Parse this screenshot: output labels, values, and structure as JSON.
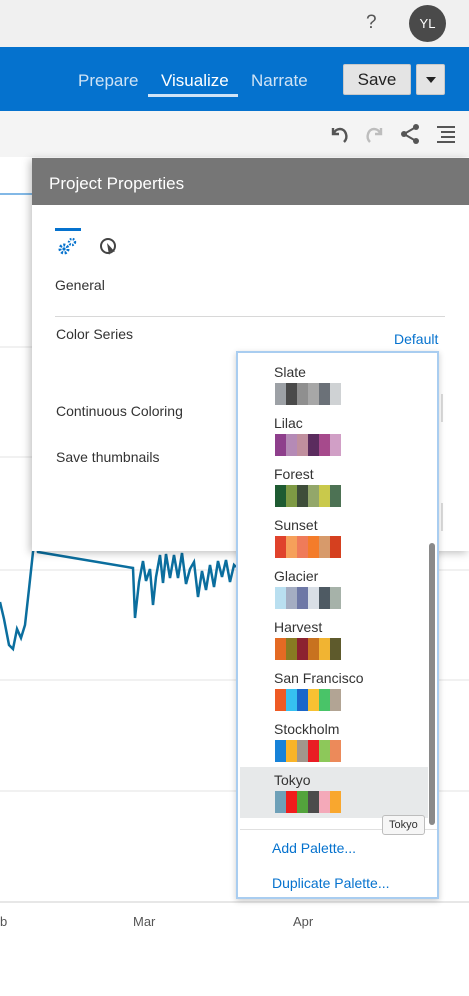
{
  "header": {
    "help_label": "?",
    "avatar_initials": "YL"
  },
  "nav": {
    "tabs": [
      {
        "label": "Prepare"
      },
      {
        "label": "Visualize"
      },
      {
        "label": "Narrate"
      }
    ],
    "active_tab": "Visualize",
    "save_label": "Save"
  },
  "toolbar": {
    "icons": [
      "undo-icon",
      "redo-icon",
      "share-icon",
      "menu-icon"
    ]
  },
  "chart": {
    "x_ticks": [
      "b",
      "Mar",
      "Apr"
    ]
  },
  "dialog": {
    "title": "Project Properties",
    "tabs": [
      "gear-icon",
      "cursor-icon"
    ],
    "section": "General",
    "properties": {
      "color_series": "Color Series",
      "continuous_coloring": "Continuous Coloring",
      "save_thumbnails": "Save thumbnails"
    },
    "color_series_value": "Default"
  },
  "palette_dropdown": {
    "palettes": [
      {
        "name": "Slate",
        "colors": [
          "#9da1a6",
          "#4a4a4a",
          "#8f8f8f",
          "#a7a7a7",
          "#6b7178",
          "#cfd2d4"
        ]
      },
      {
        "name": "Lilac",
        "colors": [
          "#8e3f8c",
          "#b58ab6",
          "#c08f9e",
          "#5b2c5e",
          "#a64a8c",
          "#d19fc6"
        ]
      },
      {
        "name": "Forest",
        "colors": [
          "#1e5b32",
          "#7e9a44",
          "#3e4d3a",
          "#93a76a",
          "#c9c94b",
          "#4d7254"
        ]
      },
      {
        "name": "Sunset",
        "colors": [
          "#e0422c",
          "#f6a05a",
          "#ef7b5a",
          "#f47c2a",
          "#d79a6b",
          "#d5401f"
        ]
      },
      {
        "name": "Glacier",
        "colors": [
          "#b9dff0",
          "#a4adc2",
          "#6e78a6",
          "#d9dfe6",
          "#4e5a63",
          "#a6b2a9"
        ]
      },
      {
        "name": "Harvest",
        "colors": [
          "#e46a23",
          "#887b22",
          "#8c2230",
          "#c8721f",
          "#f1b432",
          "#5e5a2c"
        ]
      },
      {
        "name": "San Francisco",
        "colors": [
          "#ee5a24",
          "#36c1f0",
          "#1b66c9",
          "#f8c132",
          "#49c468",
          "#b2a494"
        ]
      },
      {
        "name": "Stockholm",
        "colors": [
          "#1682d8",
          "#f9b428",
          "#a1968c",
          "#ea1c24",
          "#8dc85a",
          "#ec8a5a"
        ]
      },
      {
        "name": "Tokyo",
        "colors": [
          "#6ea0b8",
          "#f01c1c",
          "#53a33c",
          "#4c4c4c",
          "#f4a9b9",
          "#f9a72e"
        ]
      }
    ],
    "hovered": "Tokyo",
    "add_label": "Add Palette...",
    "duplicate_label": "Duplicate Palette..."
  },
  "tooltip": {
    "text": "Tokyo"
  }
}
